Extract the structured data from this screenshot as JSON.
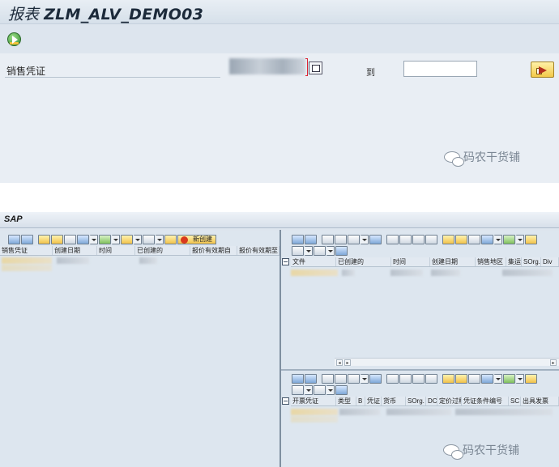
{
  "screen1": {
    "title_prefix": "报表",
    "title_program": "ZLM_ALV_DEMO03",
    "field_label": "销售凭证",
    "to_label": "到",
    "watermark": "码农干货铺"
  },
  "screen2": {
    "window_title": "SAP",
    "new_create_label": "新创建",
    "watermark": "码农干货铺",
    "left_grid_columns": [
      "销售凭证",
      "创建日期",
      "时间",
      "已创建的",
      "报价有效期自",
      "报价有效期至"
    ],
    "right_top_columns": [
      "文件",
      "已创建的",
      "时间",
      "创建日期",
      "销售地区",
      "集运",
      "SOrg.",
      "Div"
    ],
    "right_bottom_columns": [
      "开票凭证",
      "类型",
      "B",
      "凭证",
      "货币",
      "SOrg.",
      "DC",
      "定价过程",
      "凭证条件编号",
      "SC",
      "出具发票"
    ]
  },
  "colors": {
    "panel_bg": "#dde6ef",
    "selection_bg": "#e9eef4",
    "accent_yellow": "#f1c24a",
    "execute_green": "#2e8a2e"
  },
  "icons": {
    "execute": "execute-icon",
    "multiple_selection": "multiple-selection-icon",
    "exit": "arrow-exit-icon",
    "watermark": "wechat-icon"
  }
}
